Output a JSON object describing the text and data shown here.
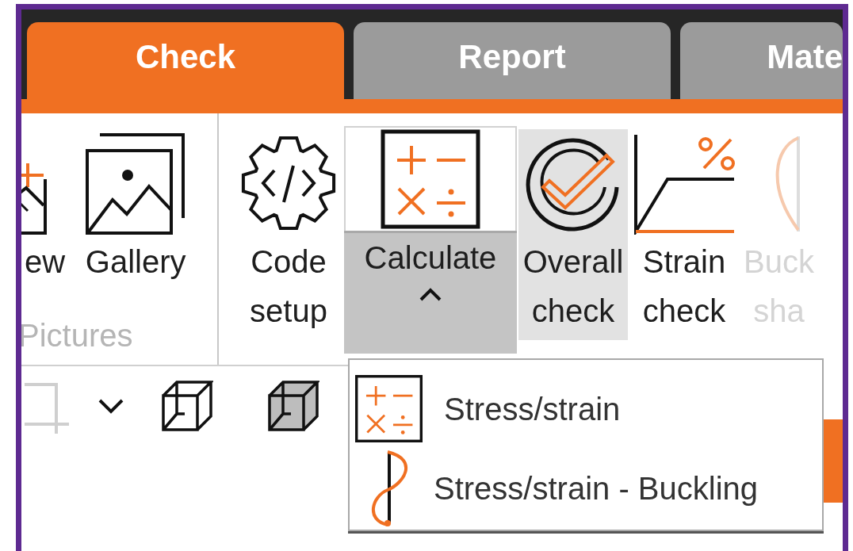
{
  "tabs": [
    {
      "label": "Check",
      "selected": true
    },
    {
      "label": "Report",
      "selected": false
    },
    {
      "label": "Mate",
      "selected": false
    }
  ],
  "ribbon": {
    "groups": [
      {
        "label": "Pictures",
        "items": [
          {
            "kind": "view",
            "lines": [
              "ew"
            ],
            "pressed": false,
            "highlighted": false,
            "disabled": false
          },
          {
            "kind": "gallery",
            "lines": [
              "Gallery"
            ],
            "pressed": false,
            "highlighted": false,
            "disabled": false
          }
        ]
      },
      {
        "items": [
          {
            "kind": "code",
            "lines": [
              "Code",
              "setup"
            ],
            "pressed": false,
            "highlighted": false,
            "disabled": false
          },
          {
            "kind": "calculate",
            "lines": [
              "Calculate"
            ],
            "pressed": true,
            "highlighted": false,
            "disabled": false,
            "expanded": true
          },
          {
            "kind": "overall",
            "lines": [
              "Overall",
              "check"
            ],
            "pressed": false,
            "highlighted": true,
            "disabled": false
          },
          {
            "kind": "strain",
            "lines": [
              "Strain",
              "check"
            ],
            "pressed": false,
            "highlighted": false,
            "disabled": false
          },
          {
            "kind": "buckling",
            "lines": [
              "Buck",
              "sha"
            ],
            "pressed": false,
            "highlighted": false,
            "disabled": true
          }
        ]
      }
    ]
  },
  "toolbar": [
    {
      "kind": "crop",
      "disabled": true
    },
    {
      "kind": "caret",
      "disabled": false
    },
    {
      "kind": "wire-box",
      "disabled": false
    },
    {
      "kind": "solid-box",
      "disabled": false
    }
  ],
  "menu": [
    {
      "kind": "calculate",
      "label": "Stress/strain"
    },
    {
      "kind": "buckling",
      "label": "Stress/strain - Buckling"
    }
  ]
}
